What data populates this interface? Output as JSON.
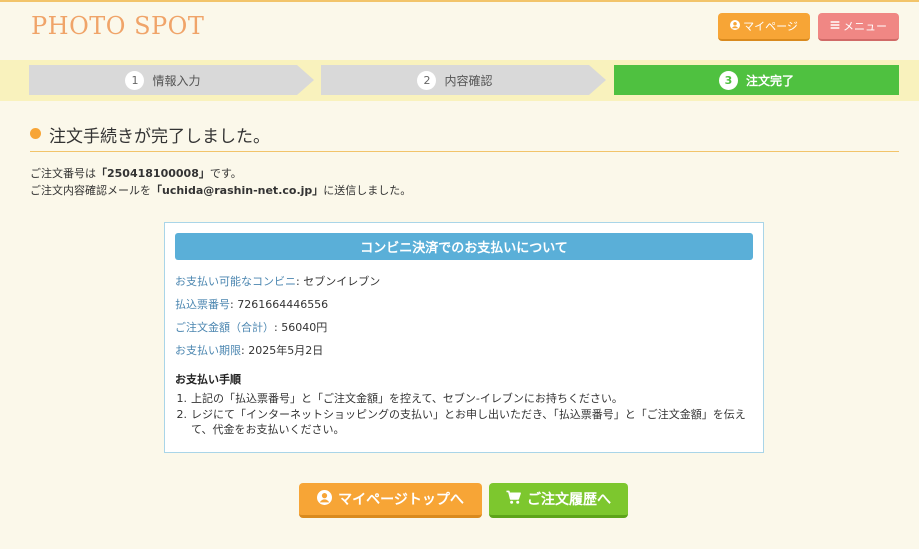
{
  "header": {
    "logo": "PHOTO SPOT",
    "mypage_label": "マイページ",
    "menu_label": "メニュー"
  },
  "steps": [
    {
      "num": "1",
      "label": "情報入力"
    },
    {
      "num": "2",
      "label": "内容確認"
    },
    {
      "num": "3",
      "label": "注文完了"
    }
  ],
  "page": {
    "heading": "注文手続きが完了しました。",
    "order_prefix": "ご注文番号は",
    "order_number": "「250418100008」",
    "order_suffix": "です。",
    "mail_prefix": "ご注文内容確認メールを",
    "mail_address": "「uchida@rashin-net.co.jp」",
    "mail_suffix": "に送信しました。"
  },
  "payment": {
    "title": "コンビニ決済でのお支払いについて",
    "rows": [
      {
        "label": "お支払い可能なコンビニ",
        "value": ": セブンイレブン"
      },
      {
        "label": "払込票番号",
        "value": ": 7261664446556"
      },
      {
        "label": "ご注文金額（合計）",
        "value": ": 56040円"
      },
      {
        "label": "お支払い期限",
        "value": ": 2025年5月2日"
      }
    ],
    "procedure_title": "お支払い手順",
    "procedure": [
      {
        "num": "1.",
        "text": "上記の「払込票番号」と「ご注文金額」を控えて、セブン-イレブンにお持ちください。"
      },
      {
        "num": "2.",
        "text": "レジにて「インターネットショッピングの支払い」とお申し出いただき、「払込票番号」と「ご注文金額」を伝えて、代金をお支払いください。"
      }
    ]
  },
  "buttons": {
    "mypage_top": "マイページトップへ",
    "order_history": "ご注文履歴へ"
  },
  "colors": {
    "accent_orange": "#f7a536",
    "menu_red": "#f08784",
    "step_active": "#4fc140",
    "info_blue": "#5aafd8",
    "history_green": "#7dc72e"
  },
  "icons": {
    "mypage": "user-circle-icon",
    "menu": "bars-icon",
    "cart": "cart-icon"
  }
}
